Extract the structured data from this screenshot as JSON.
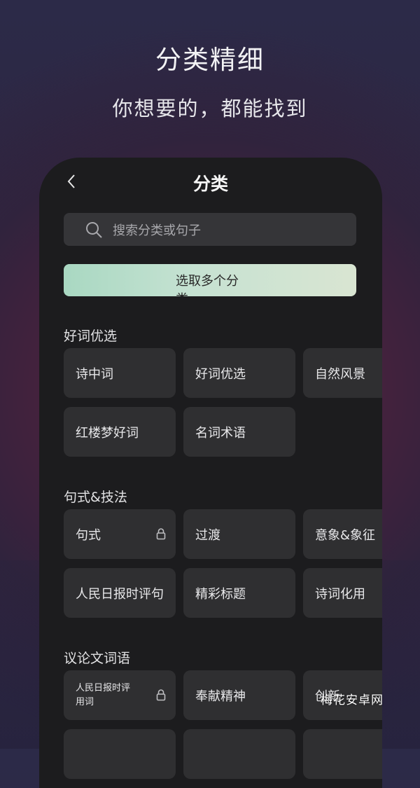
{
  "promo": {
    "headline": "分类精细",
    "subheadline": "你想要的，都能找到"
  },
  "nav": {
    "title": "分类",
    "back_icon": "chevron-left-icon"
  },
  "search": {
    "placeholder": "搜索分类或句子",
    "icon": "search-icon"
  },
  "select_button": {
    "label": "选取多个分类"
  },
  "sections": [
    {
      "title": "好词优选",
      "items": [
        {
          "label": "诗中词",
          "locked": false
        },
        {
          "label": "好词优选",
          "locked": false
        },
        {
          "label": "自然风景",
          "locked": false
        },
        {
          "label": "红楼梦好词",
          "locked": false
        },
        {
          "label": "名词术语",
          "locked": false
        }
      ]
    },
    {
      "title": "句式&技法",
      "items": [
        {
          "label": "句式",
          "locked": true
        },
        {
          "label": "过渡",
          "locked": false
        },
        {
          "label": "意象&象征",
          "locked": false
        },
        {
          "label": "人民日报时评句",
          "locked": false
        },
        {
          "label": "精彩标题",
          "locked": false
        },
        {
          "label": "诗词化用",
          "locked": false
        }
      ]
    },
    {
      "title": "议论文词语",
      "items": [
        {
          "label": "人民日报时评用词",
          "locked": true
        },
        {
          "label": "奉献精神",
          "locked": false
        },
        {
          "label": "创新",
          "locked": false
        }
      ]
    }
  ],
  "watermark": "梅花安卓网",
  "colors": {
    "accent_gradient_start": "#a9d8c2",
    "accent_gradient_end": "#d9e5d2",
    "card_bg": "#2f2f31",
    "panel_bg": "#1c1c1e"
  }
}
